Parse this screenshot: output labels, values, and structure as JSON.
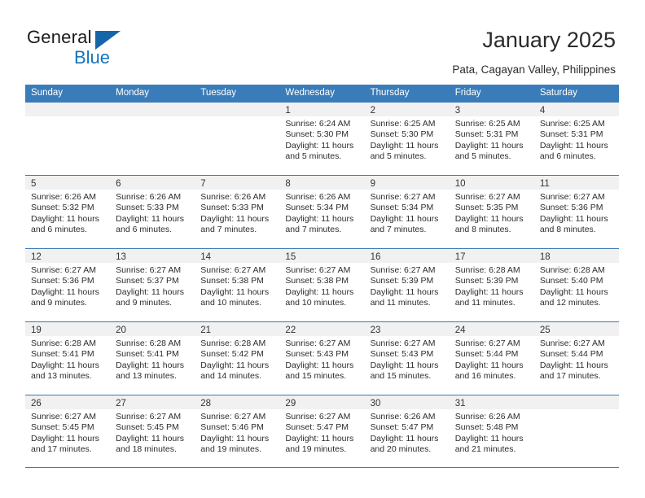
{
  "brand": {
    "name_line1": "General",
    "name_line2": "Blue",
    "triangle_color": "#1565a8",
    "blue_color": "#1574bd"
  },
  "header": {
    "title": "January 2025",
    "subtitle": "Pata, Cagayan Valley, Philippines"
  },
  "theme": {
    "header_blue": "#3a7cb9",
    "day_band_gray": "#f1f1f1",
    "text": "#2c2c2c"
  },
  "weekdays": [
    "Sunday",
    "Monday",
    "Tuesday",
    "Wednesday",
    "Thursday",
    "Friday",
    "Saturday"
  ],
  "weeks": [
    [
      {
        "day": "",
        "sunrise": "",
        "sunset": "",
        "daylight_line1": "",
        "daylight_line2": "",
        "empty": true
      },
      {
        "day": "",
        "sunrise": "",
        "sunset": "",
        "daylight_line1": "",
        "daylight_line2": "",
        "empty": true
      },
      {
        "day": "",
        "sunrise": "",
        "sunset": "",
        "daylight_line1": "",
        "daylight_line2": "",
        "empty": true
      },
      {
        "day": "1",
        "sunrise": "Sunrise: 6:24 AM",
        "sunset": "Sunset: 5:30 PM",
        "daylight_line1": "Daylight: 11 hours",
        "daylight_line2": "and 5 minutes."
      },
      {
        "day": "2",
        "sunrise": "Sunrise: 6:25 AM",
        "sunset": "Sunset: 5:30 PM",
        "daylight_line1": "Daylight: 11 hours",
        "daylight_line2": "and 5 minutes."
      },
      {
        "day": "3",
        "sunrise": "Sunrise: 6:25 AM",
        "sunset": "Sunset: 5:31 PM",
        "daylight_line1": "Daylight: 11 hours",
        "daylight_line2": "and 5 minutes."
      },
      {
        "day": "4",
        "sunrise": "Sunrise: 6:25 AM",
        "sunset": "Sunset: 5:31 PM",
        "daylight_line1": "Daylight: 11 hours",
        "daylight_line2": "and 6 minutes."
      }
    ],
    [
      {
        "day": "5",
        "sunrise": "Sunrise: 6:26 AM",
        "sunset": "Sunset: 5:32 PM",
        "daylight_line1": "Daylight: 11 hours",
        "daylight_line2": "and 6 minutes."
      },
      {
        "day": "6",
        "sunrise": "Sunrise: 6:26 AM",
        "sunset": "Sunset: 5:33 PM",
        "daylight_line1": "Daylight: 11 hours",
        "daylight_line2": "and 6 minutes."
      },
      {
        "day": "7",
        "sunrise": "Sunrise: 6:26 AM",
        "sunset": "Sunset: 5:33 PM",
        "daylight_line1": "Daylight: 11 hours",
        "daylight_line2": "and 7 minutes."
      },
      {
        "day": "8",
        "sunrise": "Sunrise: 6:26 AM",
        "sunset": "Sunset: 5:34 PM",
        "daylight_line1": "Daylight: 11 hours",
        "daylight_line2": "and 7 minutes."
      },
      {
        "day": "9",
        "sunrise": "Sunrise: 6:27 AM",
        "sunset": "Sunset: 5:34 PM",
        "daylight_line1": "Daylight: 11 hours",
        "daylight_line2": "and 7 minutes."
      },
      {
        "day": "10",
        "sunrise": "Sunrise: 6:27 AM",
        "sunset": "Sunset: 5:35 PM",
        "daylight_line1": "Daylight: 11 hours",
        "daylight_line2": "and 8 minutes."
      },
      {
        "day": "11",
        "sunrise": "Sunrise: 6:27 AM",
        "sunset": "Sunset: 5:36 PM",
        "daylight_line1": "Daylight: 11 hours",
        "daylight_line2": "and 8 minutes."
      }
    ],
    [
      {
        "day": "12",
        "sunrise": "Sunrise: 6:27 AM",
        "sunset": "Sunset: 5:36 PM",
        "daylight_line1": "Daylight: 11 hours",
        "daylight_line2": "and 9 minutes."
      },
      {
        "day": "13",
        "sunrise": "Sunrise: 6:27 AM",
        "sunset": "Sunset: 5:37 PM",
        "daylight_line1": "Daylight: 11 hours",
        "daylight_line2": "and 9 minutes."
      },
      {
        "day": "14",
        "sunrise": "Sunrise: 6:27 AM",
        "sunset": "Sunset: 5:38 PM",
        "daylight_line1": "Daylight: 11 hours",
        "daylight_line2": "and 10 minutes."
      },
      {
        "day": "15",
        "sunrise": "Sunrise: 6:27 AM",
        "sunset": "Sunset: 5:38 PM",
        "daylight_line1": "Daylight: 11 hours",
        "daylight_line2": "and 10 minutes."
      },
      {
        "day": "16",
        "sunrise": "Sunrise: 6:27 AM",
        "sunset": "Sunset: 5:39 PM",
        "daylight_line1": "Daylight: 11 hours",
        "daylight_line2": "and 11 minutes."
      },
      {
        "day": "17",
        "sunrise": "Sunrise: 6:28 AM",
        "sunset": "Sunset: 5:39 PM",
        "daylight_line1": "Daylight: 11 hours",
        "daylight_line2": "and 11 minutes."
      },
      {
        "day": "18",
        "sunrise": "Sunrise: 6:28 AM",
        "sunset": "Sunset: 5:40 PM",
        "daylight_line1": "Daylight: 11 hours",
        "daylight_line2": "and 12 minutes."
      }
    ],
    [
      {
        "day": "19",
        "sunrise": "Sunrise: 6:28 AM",
        "sunset": "Sunset: 5:41 PM",
        "daylight_line1": "Daylight: 11 hours",
        "daylight_line2": "and 13 minutes."
      },
      {
        "day": "20",
        "sunrise": "Sunrise: 6:28 AM",
        "sunset": "Sunset: 5:41 PM",
        "daylight_line1": "Daylight: 11 hours",
        "daylight_line2": "and 13 minutes."
      },
      {
        "day": "21",
        "sunrise": "Sunrise: 6:28 AM",
        "sunset": "Sunset: 5:42 PM",
        "daylight_line1": "Daylight: 11 hours",
        "daylight_line2": "and 14 minutes."
      },
      {
        "day": "22",
        "sunrise": "Sunrise: 6:27 AM",
        "sunset": "Sunset: 5:43 PM",
        "daylight_line1": "Daylight: 11 hours",
        "daylight_line2": "and 15 minutes."
      },
      {
        "day": "23",
        "sunrise": "Sunrise: 6:27 AM",
        "sunset": "Sunset: 5:43 PM",
        "daylight_line1": "Daylight: 11 hours",
        "daylight_line2": "and 15 minutes."
      },
      {
        "day": "24",
        "sunrise": "Sunrise: 6:27 AM",
        "sunset": "Sunset: 5:44 PM",
        "daylight_line1": "Daylight: 11 hours",
        "daylight_line2": "and 16 minutes."
      },
      {
        "day": "25",
        "sunrise": "Sunrise: 6:27 AM",
        "sunset": "Sunset: 5:44 PM",
        "daylight_line1": "Daylight: 11 hours",
        "daylight_line2": "and 17 minutes."
      }
    ],
    [
      {
        "day": "26",
        "sunrise": "Sunrise: 6:27 AM",
        "sunset": "Sunset: 5:45 PM",
        "daylight_line1": "Daylight: 11 hours",
        "daylight_line2": "and 17 minutes."
      },
      {
        "day": "27",
        "sunrise": "Sunrise: 6:27 AM",
        "sunset": "Sunset: 5:45 PM",
        "daylight_line1": "Daylight: 11 hours",
        "daylight_line2": "and 18 minutes."
      },
      {
        "day": "28",
        "sunrise": "Sunrise: 6:27 AM",
        "sunset": "Sunset: 5:46 PM",
        "daylight_line1": "Daylight: 11 hours",
        "daylight_line2": "and 19 minutes."
      },
      {
        "day": "29",
        "sunrise": "Sunrise: 6:27 AM",
        "sunset": "Sunset: 5:47 PM",
        "daylight_line1": "Daylight: 11 hours",
        "daylight_line2": "and 19 minutes."
      },
      {
        "day": "30",
        "sunrise": "Sunrise: 6:26 AM",
        "sunset": "Sunset: 5:47 PM",
        "daylight_line1": "Daylight: 11 hours",
        "daylight_line2": "and 20 minutes."
      },
      {
        "day": "31",
        "sunrise": "Sunrise: 6:26 AM",
        "sunset": "Sunset: 5:48 PM",
        "daylight_line1": "Daylight: 11 hours",
        "daylight_line2": "and 21 minutes."
      },
      {
        "day": "",
        "sunrise": "",
        "sunset": "",
        "daylight_line1": "",
        "daylight_line2": "",
        "empty": true
      }
    ]
  ]
}
